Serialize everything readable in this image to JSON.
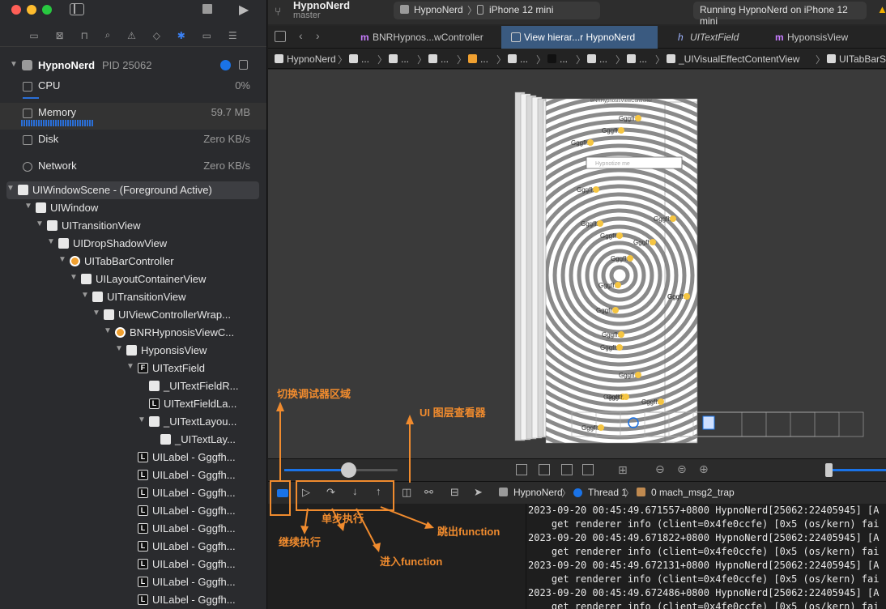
{
  "project": {
    "name": "HypnoNerd",
    "branch": "master"
  },
  "toolbar": {
    "scheme": "HypnoNerd",
    "device": "iPhone 12 mini",
    "status": "Running HypnoNerd on iPhone 12 mini"
  },
  "tabs": [
    {
      "label": "BNRHypnos...wController",
      "icon": "m"
    },
    {
      "label": "View hierar...r HypnoNerd",
      "icon": "view"
    },
    {
      "label": "UITextField",
      "icon": "c"
    },
    {
      "label": "HyponsisView",
      "icon": "m"
    }
  ],
  "jumpbar": {
    "items": [
      "HypnoNerd",
      "...",
      "...",
      "...",
      "...",
      "...",
      "...",
      "...",
      "...",
      "_UIVisualEffectContentView",
      "UITabBarSwappa"
    ]
  },
  "debug_nav": {
    "process": "HypnoNerd",
    "pid": "PID 25062",
    "gauges": [
      {
        "label": "CPU",
        "value": "0%"
      },
      {
        "label": "Memory",
        "value": "59.7 MB"
      },
      {
        "label": "Disk",
        "value": "Zero KB/s"
      },
      {
        "label": "Network",
        "value": "Zero KB/s"
      }
    ]
  },
  "hierarchy": [
    {
      "label": "UIWindowScene - (Foreground Active)",
      "depth": 0,
      "kind": "white",
      "open": true
    },
    {
      "label": "UIWindow",
      "depth": 1,
      "kind": "white",
      "open": true
    },
    {
      "label": "UITransitionView",
      "depth": 2,
      "kind": "white",
      "open": true
    },
    {
      "label": "UIDropShadowView",
      "depth": 3,
      "kind": "white",
      "open": true
    },
    {
      "label": "UITabBarController",
      "depth": 4,
      "kind": "orange",
      "open": true
    },
    {
      "label": "UILayoutContainerView",
      "depth": 5,
      "kind": "white",
      "open": true
    },
    {
      "label": "UITransitionView",
      "depth": 6,
      "kind": "white",
      "open": true
    },
    {
      "label": "UIViewControllerWrap...",
      "depth": 7,
      "kind": "white",
      "open": true
    },
    {
      "label": "BNRHypnosisViewC...",
      "depth": 8,
      "kind": "orange",
      "open": true
    },
    {
      "label": "HyponsisView",
      "depth": 9,
      "kind": "white",
      "open": true
    },
    {
      "label": "UITextField",
      "depth": 10,
      "kind": "F",
      "open": true
    },
    {
      "label": "_UITextFieldR...",
      "depth": 11,
      "kind": "white",
      "open": false
    },
    {
      "label": "UITextFieldLa...",
      "depth": 11,
      "kind": "L",
      "open": false
    },
    {
      "label": "_UITextLayou...",
      "depth": 11,
      "kind": "white",
      "open": true
    },
    {
      "label": "_UITextLay...",
      "depth": 12,
      "kind": "white",
      "open": false
    },
    {
      "label": "UILabel - Gggfh...",
      "depth": 10,
      "kind": "L",
      "open": false
    },
    {
      "label": "UILabel - Gggfh...",
      "depth": 10,
      "kind": "L",
      "open": false
    },
    {
      "label": "UILabel - Gggfh...",
      "depth": 10,
      "kind": "L",
      "open": false
    },
    {
      "label": "UILabel - Gggfh...",
      "depth": 10,
      "kind": "L",
      "open": false
    },
    {
      "label": "UILabel - Gggfh...",
      "depth": 10,
      "kind": "L",
      "open": false
    },
    {
      "label": "UILabel - Gggfh...",
      "depth": 10,
      "kind": "L",
      "open": false
    },
    {
      "label": "UILabel - Gggfh...",
      "depth": 10,
      "kind": "L",
      "open": false
    },
    {
      "label": "UILabel - Gggfh...",
      "depth": 10,
      "kind": "L",
      "open": false
    },
    {
      "label": "UILabel - Gggfh...",
      "depth": 10,
      "kind": "L",
      "open": false
    }
  ],
  "canvas": {
    "header_label": "BNRHypnosisViewController",
    "field_placeholder": "Hypnotize me",
    "label_text": "Gggfh"
  },
  "debug_bar": {
    "process": "HypnoNerd",
    "thread": "Thread 1",
    "frame": "0 mach_msg2_trap"
  },
  "console": [
    "2023-09-20 00:45:49.671557+0800 HypnoNerd[25062:22405945] [A",
    "    get renderer info (client=0x4fe0ccfe) [0x5 (os/kern) fai",
    "2023-09-20 00:45:49.671822+0800 HypnoNerd[25062:22405945] [A",
    "    get renderer info (client=0x4fe0ccfe) [0x5 (os/kern) fai",
    "2023-09-20 00:45:49.672131+0800 HypnoNerd[25062:22405945] [A",
    "    get renderer info (client=0x4fe0ccfe) [0x5 (os/kern) fai",
    "2023-09-20 00:45:49.672486+0800 HypnoNerd[25062:22405945] [A",
    "    get renderer info (client=0x4fe0ccfe) [0x5 (os/kern) fai"
  ],
  "annotations": {
    "toggle_debug_area": "切换调试器区域",
    "view_debugger": "UI 图层查看器",
    "step_over": "单步执行",
    "continue": "继续执行",
    "step_out": "跳出function",
    "step_into": "进入function"
  },
  "colors": {
    "accent": "#1a73e8",
    "annotation": "#f08b2e",
    "selected_tab": "#3a5a80"
  }
}
